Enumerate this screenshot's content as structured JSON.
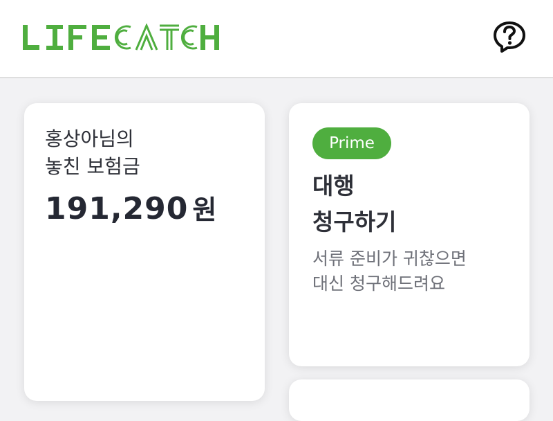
{
  "header": {
    "logo_text": "LIFECATCH",
    "brand_color": "#4fae3f",
    "help_icon": "question-bubble-icon"
  },
  "cards": {
    "missed": {
      "title_line1": "홍상아님의",
      "title_line2": "놓친 보험금",
      "amount": "191,290",
      "unit": "원"
    },
    "claim": {
      "badge": "Prime",
      "title_line1": "대행",
      "title_line2": "청구하기",
      "desc_line1": "서류 준비가 귀찮으면",
      "desc_line2": "대신 청구해드려요"
    }
  }
}
